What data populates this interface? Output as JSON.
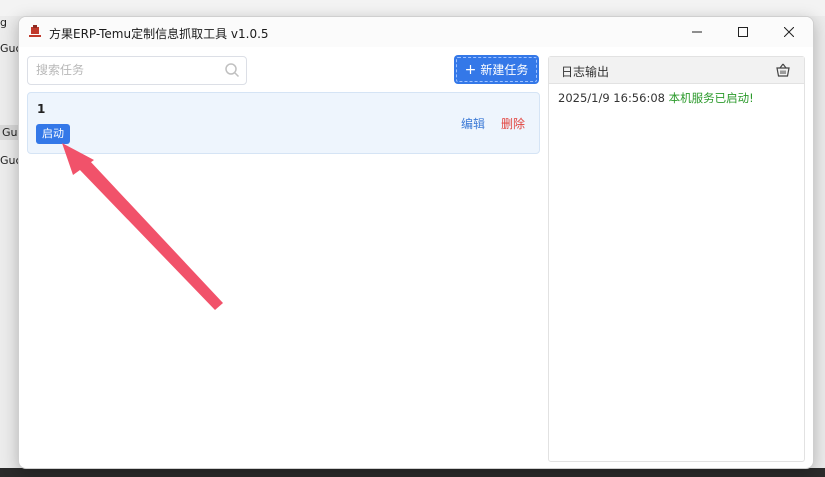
{
  "window": {
    "title": "方果ERP-Temu定制信息抓取工具 v1.0.5"
  },
  "background": {
    "fragments": [
      "g",
      "Guc",
      "Guc",
      "Guc"
    ]
  },
  "left": {
    "search": {
      "placeholder": "搜索任务",
      "value": ""
    },
    "new_task_label": "新建任务",
    "tasks": [
      {
        "name": "1",
        "start_label": "启动",
        "edit_label": "编辑",
        "delete_label": "删除"
      }
    ]
  },
  "log": {
    "title": "日志输出",
    "entries": [
      {
        "time": "2025/1/9 16:56:08",
        "message": "本机服务已启动!"
      }
    ]
  },
  "colors": {
    "accent": "#3478e8",
    "delete": "#e2423d",
    "log_success": "#2b9a2b",
    "annotation_arrow": "#f1526a"
  }
}
